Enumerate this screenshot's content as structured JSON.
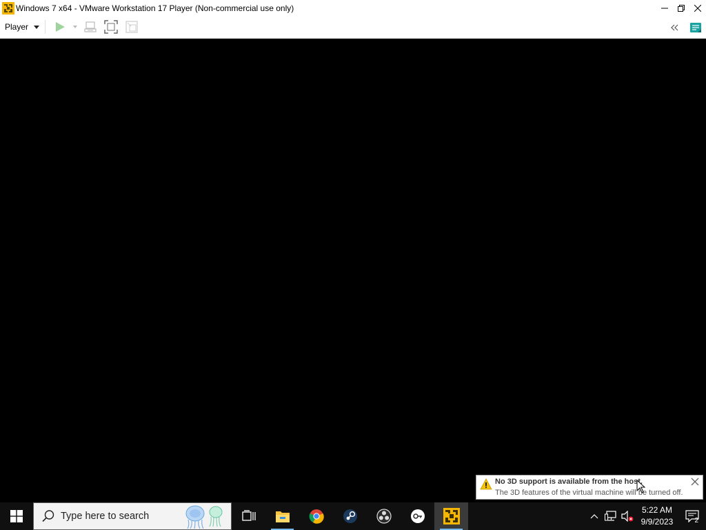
{
  "window": {
    "title": "Windows 7 x64 - VMware Workstation 17 Player (Non-commercial use only)",
    "icons": {
      "app": "vmware-icon",
      "minimize": "minimize-icon",
      "restore": "restore-icon",
      "close": "close-icon"
    }
  },
  "toolbar": {
    "player_menu_label": "Player",
    "buttons": [
      "play-icon",
      "ctrl-alt-del-icon",
      "fullscreen-icon",
      "unity-icon"
    ],
    "right_buttons": [
      "collapse-icon",
      "message-log-icon"
    ],
    "accent": "#5cb85c"
  },
  "notification": {
    "title": "No 3D support is available from the host.",
    "body": "The 3D features of the virtual machine will be turned off.",
    "icon": "warning-icon"
  },
  "taskbar": {
    "search_placeholder": "Type here to search",
    "apps": [
      "task-view-icon",
      "file-explorer-icon",
      "chrome-icon",
      "steam-icon",
      "obs-icon",
      "keypass-icon",
      "vmware-player-icon"
    ],
    "active_app": "vmware-player-icon",
    "clock_time": "5:22 AM",
    "clock_date": "9/9/2023",
    "notification_count": "2"
  }
}
